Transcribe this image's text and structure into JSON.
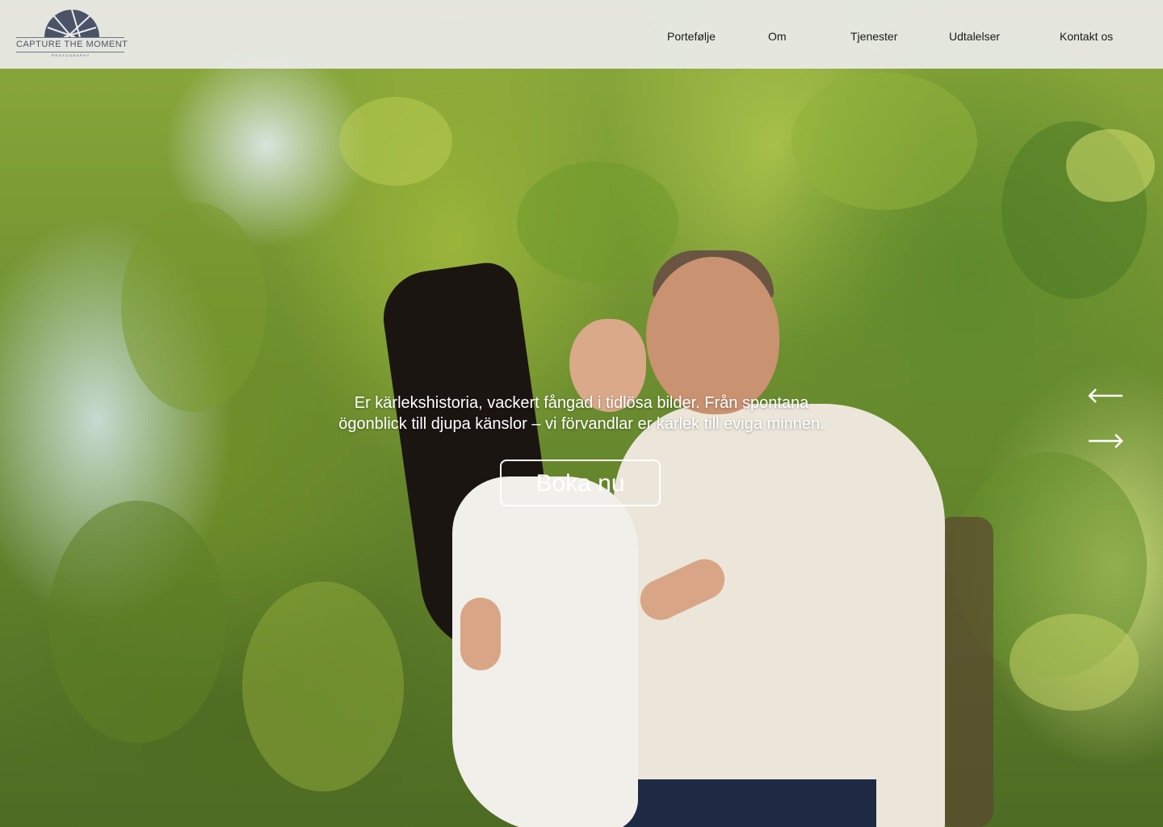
{
  "header": {
    "logo": {
      "title": "CAPTURE THE MOMENT",
      "subtitle": "PHOTOGRAPHY"
    },
    "nav": [
      {
        "label": "Portefølje"
      },
      {
        "label": "Om"
      },
      {
        "label": "Tjenester"
      },
      {
        "label": "Udtalelser"
      },
      {
        "label": "Kontakt os"
      }
    ]
  },
  "hero": {
    "tagline_line1": "Er kärlekshistoria, vackert fångad i tidlösa bilder. Från spontana",
    "tagline_line2": "ögonblick till djupa känslor – vi förvandlar er kärlek till eviga minnen.",
    "cta_label": "Boka nu",
    "prev_icon": "arrow-left-icon",
    "next_icon": "arrow-right-icon"
  },
  "colors": {
    "header_bg": "#ececec",
    "nav_text": "#1a1a1a",
    "logo": "#4b5368",
    "hero_text": "#ffffff"
  }
}
